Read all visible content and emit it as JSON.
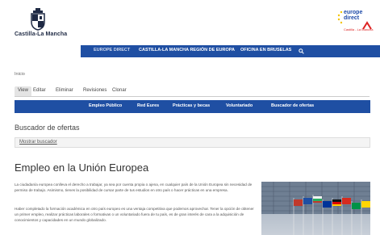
{
  "header": {
    "brand": "Castilla-La Mancha",
    "ed_logo_line1": "europe",
    "ed_logo_line2": "direct",
    "ed_logo_sub": "Castilla - La Mancha"
  },
  "topnav": {
    "items": [
      "EUROPE DIRECT",
      "CASTILLA-LA MANCHA REGIÓN DE EUROPA",
      "OFICINA EN BRUSELAS"
    ],
    "search_icon": "search-icon"
  },
  "breadcrumb": "Inicio",
  "tabs": [
    "View",
    "Editar",
    "Eliminar",
    "Revisiones",
    "Clonar"
  ],
  "subnav": [
    "Empleo Público",
    "Red Eures",
    "Prácticas y becas",
    "Voluntariado",
    "Buscador de ofertas"
  ],
  "finder": {
    "title": "Buscador de ofertas",
    "toggle": "Mostrar buscador"
  },
  "article": {
    "title": "Empleo en la Unión Europea",
    "p1": "La ciudadanía europea conlleva el derecho a trabajar, ya sea por cuenta propia o ajena, en cualquier país de la Unión Europea sin necesidad de permiso de trabajo. Asimismo, tienes la posibilidad de cursar parte de tus estudios en otro país o hacer prácticas en una empresa.",
    "p2": "Haber completado la formación académica en otro país europeo es una ventaja competitiva que podemos aprovechar. Tener la opción de obtener un primer empleo, realizar prácticas laborales o formativas o un voluntariado fuera de tu país, es de gran interés de cara a la adquisición de conocimientos y capacidades en un mundo globalizado."
  },
  "colors": {
    "nav_blue": "#1f4fa3"
  }
}
